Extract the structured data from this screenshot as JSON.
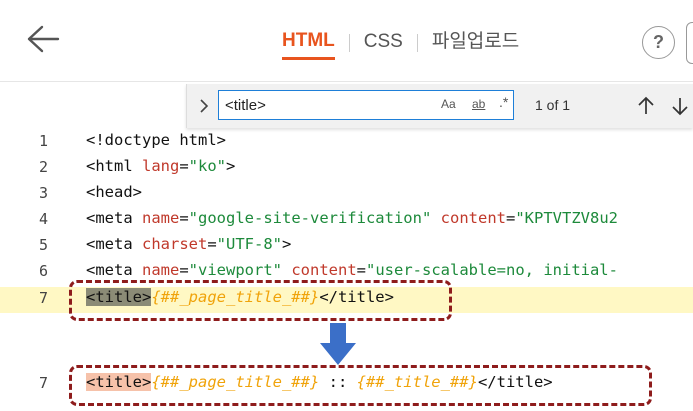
{
  "header": {
    "tabs": [
      {
        "label": "HTML",
        "active": true
      },
      {
        "label": "CSS",
        "active": false
      },
      {
        "label": "파일업로드",
        "active": false
      }
    ],
    "help_label": "?"
  },
  "find": {
    "query": "<title>",
    "opt_case": "Aa",
    "opt_word": "ab",
    "opt_regex": ".*",
    "match_count": "1 of 1"
  },
  "code": {
    "lines": [
      {
        "num": "1"
      },
      {
        "num": "2",
        "lang_val": "\"ko\""
      },
      {
        "num": "3"
      },
      {
        "num": "4",
        "name_val": "\"google-site-verification\"",
        "content_val": "\"KPTVTZV8u2"
      },
      {
        "num": "5",
        "charset_val": "\"UTF-8\""
      },
      {
        "num": "6",
        "name_val": "\"viewport\"",
        "content_val": "\"user-scalable=no, initial-"
      },
      {
        "num": "7",
        "tpl": "{##_page_title_##}"
      }
    ],
    "after": {
      "num": "7",
      "tpl1": "{##_page_title_##}",
      "sep": " :: ",
      "tpl2": "{##_title_##}"
    }
  },
  "colors": {
    "accent": "#e8541e",
    "find_border": "#1e7fd8",
    "box_border": "#8e1c1c",
    "arrow": "#3b6fc8"
  }
}
